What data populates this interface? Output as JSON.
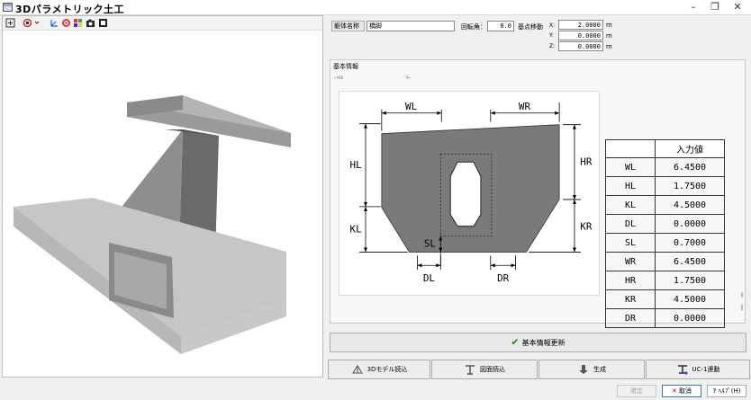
{
  "window": {
    "title": "3Dパラメトリック土工",
    "min_glyph": "–",
    "max_glyph": "❐",
    "close_glyph": "✕"
  },
  "header": {
    "member_name_label": "躯体名称",
    "member_name_value": "橋脚",
    "rotation_label": "回転角：",
    "rotation_value": "0.0",
    "base_move_label": "基点移動",
    "x_label": "X:",
    "y_label": "Y:",
    "z_label": "Z:",
    "x_value": "2.0000",
    "y_value": "0.0000",
    "z_value": "0.0000",
    "unit": "m"
  },
  "basic_info": {
    "title": "基本情報",
    "sub_left": "ｰﾄﾙﾛ",
    "sub_right": "ﾈｰ"
  },
  "figure": {
    "labels": {
      "WL": "WL",
      "WR": "WR",
      "HL": "HL",
      "KL": "KL",
      "HR": "HR",
      "KR": "KR",
      "SL": "SL",
      "DL": "DL",
      "DR": "DR"
    }
  },
  "params": {
    "header": "入力値",
    "rows": [
      {
        "name": "WL",
        "value": "6.4500"
      },
      {
        "name": "HL",
        "value": "1.7500"
      },
      {
        "name": "KL",
        "value": "4.5000"
      },
      {
        "name": "DL",
        "value": "0.0000"
      },
      {
        "name": "SL",
        "value": "0.7000"
      },
      {
        "name": "WR",
        "value": "6.4500"
      },
      {
        "name": "HR",
        "value": "1.7500"
      },
      {
        "name": "KR",
        "value": "4.5000"
      },
      {
        "name": "DR",
        "value": "0.0000"
      }
    ]
  },
  "actions": {
    "update_label": "基本情報更新",
    "tabs": [
      "3Dモデル読込",
      "図面読込",
      "生成",
      "UC-1連動"
    ],
    "ok_label": "確定",
    "cancel_label": "取消",
    "help_label": "ﾍﾙﾌﾟ(H)"
  },
  "colors": {
    "accent_blue": "#3a6ec8",
    "check_green": "#1a8a1a",
    "cancel_red": "#cc0000",
    "section_gray": "#7a7a7a"
  }
}
